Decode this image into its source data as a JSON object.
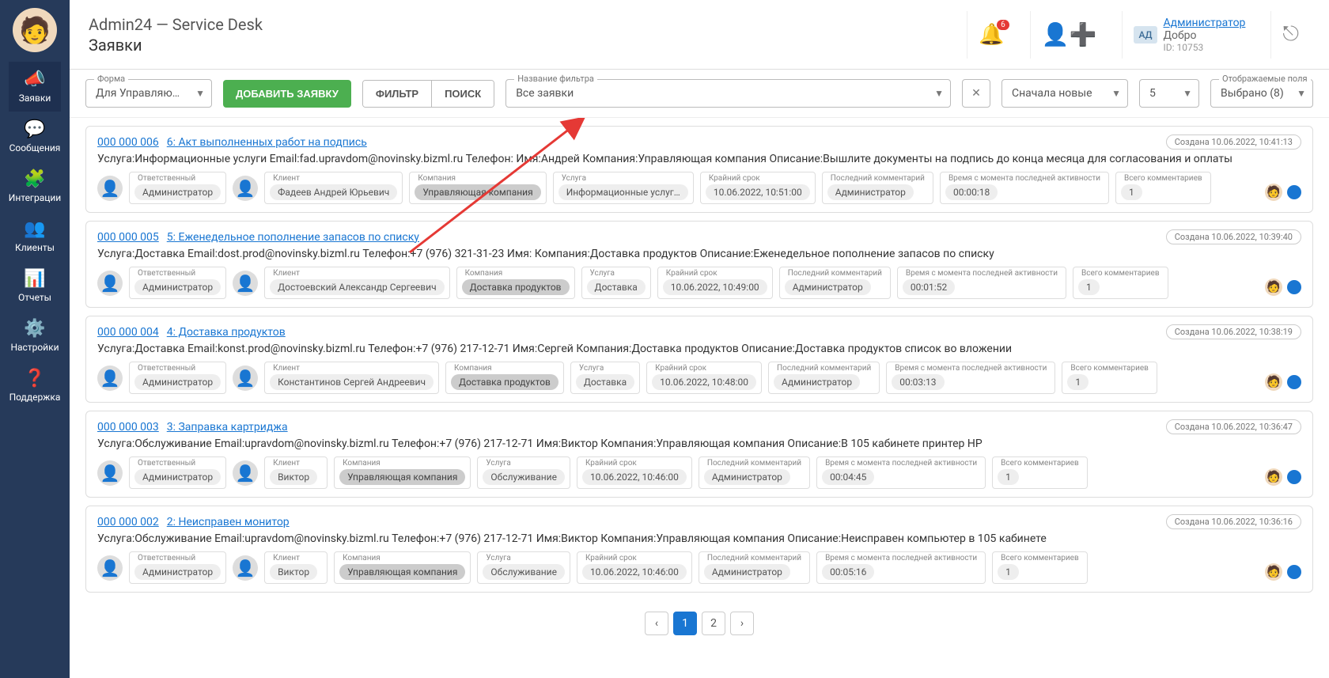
{
  "sidebar": {
    "items": [
      {
        "label": "Заявки",
        "icon": "📣"
      },
      {
        "label": "Сообщения",
        "icon": "💬"
      },
      {
        "label": "Интеграции",
        "icon": "🧩"
      },
      {
        "label": "Клиенты",
        "icon": "👥"
      },
      {
        "label": "Отчеты",
        "icon": "📊"
      },
      {
        "label": "Настройки",
        "icon": "⚙️"
      },
      {
        "label": "Поддержка",
        "icon": "❓"
      }
    ]
  },
  "header": {
    "title": "Admin24 — Service Desk",
    "subtitle": "Заявки",
    "notif_count": "6",
    "user_badge": "АД",
    "user_name": "Администратор",
    "user_greet": "Добро",
    "user_id": "ID: 10753"
  },
  "toolbar": {
    "form_label": "Форма",
    "form_value": "Для Управляющ…",
    "add_btn": "ДОБАВИТЬ ЗАЯВКУ",
    "filter_btn": "ФИЛЬТР",
    "search_btn": "ПОИСК",
    "filter_name_label": "Название фильтра",
    "filter_name_value": "Все заявки",
    "sort_value": "Сначала новые",
    "count_value": "5",
    "cols_label": "Отображаемые поля",
    "cols_value": "Выбрано (8)"
  },
  "meta_labels": {
    "responsible": "Ответственный",
    "client": "Клиент",
    "company": "Компания",
    "service": "Услуга",
    "deadline": "Крайний срок",
    "last_comment": "Последний комментарий",
    "activity": "Время с момента последней активности",
    "comments_total": "Всего комментариев"
  },
  "tickets": [
    {
      "num": "000 000 006",
      "title": "6: Акт выполненных работ на подпись",
      "created": "Создана 10.06.2022, 10:41:13",
      "desc": "Услуга:Информационные услуги Email:fad.upravdom@novinsky.bizml.ru Телефон: Имя:Андрей Компания:Управляющая компания Описание:Вышлите документы на подпись до конца месяца для согласования и оплаты",
      "responsible": "Администратор",
      "client": "Фадеев Андрей Юрьевич",
      "company": "Управляющая компания",
      "company_dark": true,
      "service": "Информационные услуг…",
      "deadline": "10.06.2022, 10:51:00",
      "last_comment": "Администратор",
      "activity": "00:00:18",
      "comments": "1"
    },
    {
      "num": "000 000 005",
      "title": "5: Еженедельное пополнение запасов по списку",
      "created": "Создана 10.06.2022, 10:39:40",
      "desc": "Услуга:Доставка Email:dost.prod@novinsky.bizml.ru Телефон:+7 (976) 321-31-23 Имя: Компания:Доставка продуктов Описание:Еженедельное пополнение запасов по списку",
      "responsible": "Администратор",
      "client": "Достоевский Александр Сергеевич",
      "company": "Доставка продуктов",
      "company_dark": true,
      "service": "Доставка",
      "deadline": "10.06.2022, 10:49:00",
      "last_comment": "Администратор",
      "activity": "00:01:52",
      "comments": "1"
    },
    {
      "num": "000 000 004",
      "title": "4: Доставка продуктов",
      "created": "Создана 10.06.2022, 10:38:19",
      "desc": "Услуга:Доставка Email:konst.prod@novinsky.bizml.ru Телефон:+7 (976) 217-12-71 Имя:Сергей Компания:Доставка продуктов Описание:Доставка продуктов список во вложении",
      "responsible": "Администратор",
      "client": "Константинов Сергей Андреевич",
      "company": "Доставка продуктов",
      "company_dark": true,
      "service": "Доставка",
      "deadline": "10.06.2022, 10:48:00",
      "last_comment": "Администратор",
      "activity": "00:03:13",
      "comments": "1"
    },
    {
      "num": "000 000 003",
      "title": "3: Заправка картриджа",
      "created": "Создана 10.06.2022, 10:36:47",
      "desc": "Услуга:Обслуживание Email:upravdom@novinsky.bizml.ru Телефон:+7 (976) 217-12-71 Имя:Виктор Компания:Управляющая компания Описание:В 105 кабинете принтер HP",
      "responsible": "Администратор",
      "client": "Виктор",
      "company": "Управляющая компания",
      "company_dark": true,
      "service": "Обслуживание",
      "deadline": "10.06.2022, 10:46:00",
      "last_comment": "Администратор",
      "activity": "00:04:45",
      "comments": "1"
    },
    {
      "num": "000 000 002",
      "title": "2: Неисправен монитор",
      "created": "Создана 10.06.2022, 10:36:16",
      "desc": "Услуга:Обслуживание Email:upravdom@novinsky.bizml.ru Телефон:+7 (976) 217-12-71 Имя:Виктор Компания:Управляющая компания Описание:Неисправен компьютер в 105 кабинете",
      "responsible": "Администратор",
      "client": "Виктор",
      "company": "Управляющая компания",
      "company_dark": true,
      "service": "Обслуживание",
      "deadline": "10.06.2022, 10:46:00",
      "last_comment": "Администратор",
      "activity": "00:05:16",
      "comments": "1"
    }
  ],
  "pagination": {
    "pages": [
      "1",
      "2"
    ],
    "active": "1"
  }
}
